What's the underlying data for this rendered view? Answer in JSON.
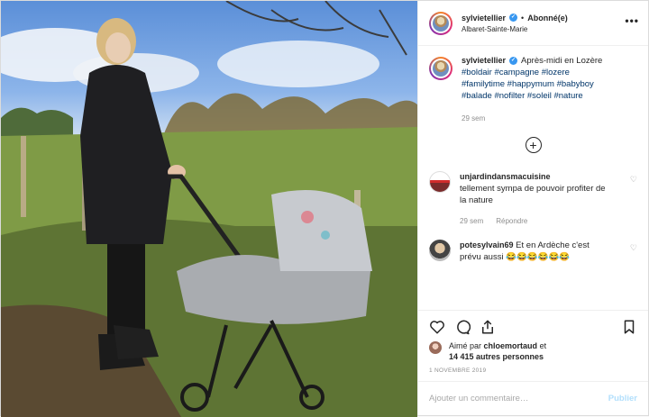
{
  "post": {
    "username": "sylvietellier",
    "follow_status": "Abonné(e)",
    "location": "Albaret-Sainte-Marie",
    "caption_text": "Après-midi en Lozère",
    "hashtags": "#boldair #campagne #lozere #familytime #happymum #babyboy #balade #nofilter #soleil #nature",
    "caption_time": "29 sem",
    "date": "1 NOVEMBRE 2019"
  },
  "comments": [
    {
      "username": "unjardindansmacuisine",
      "text": "tellement sympa de pouvoir profiter de la nature",
      "time": "29 sem",
      "reply_label": "Répondre"
    },
    {
      "username": "potesylvain69",
      "text": "Et en Ardèche c'est prévu aussi 😂😂😂😂😂😂"
    }
  ],
  "likes": {
    "liked_by_prefix": "Aimé par",
    "liked_by_user": "chloemortaud",
    "and_others": "et",
    "others_count": "14 415 autres personnes"
  },
  "add_comment": {
    "placeholder": "Ajouter un commentaire…",
    "publish_label": "Publier"
  },
  "icons": {
    "more": "more-options-icon",
    "verified": "verified-badge-icon",
    "load_more": "plus-circle-icon",
    "like": "heart-icon",
    "comment": "comment-bubble-icon",
    "share": "share-icon",
    "save": "bookmark-icon"
  },
  "colors": {
    "verified": "#3897f0",
    "hashtag": "#003569",
    "muted": "#8e8e8e",
    "publish": "#b2dffc"
  }
}
